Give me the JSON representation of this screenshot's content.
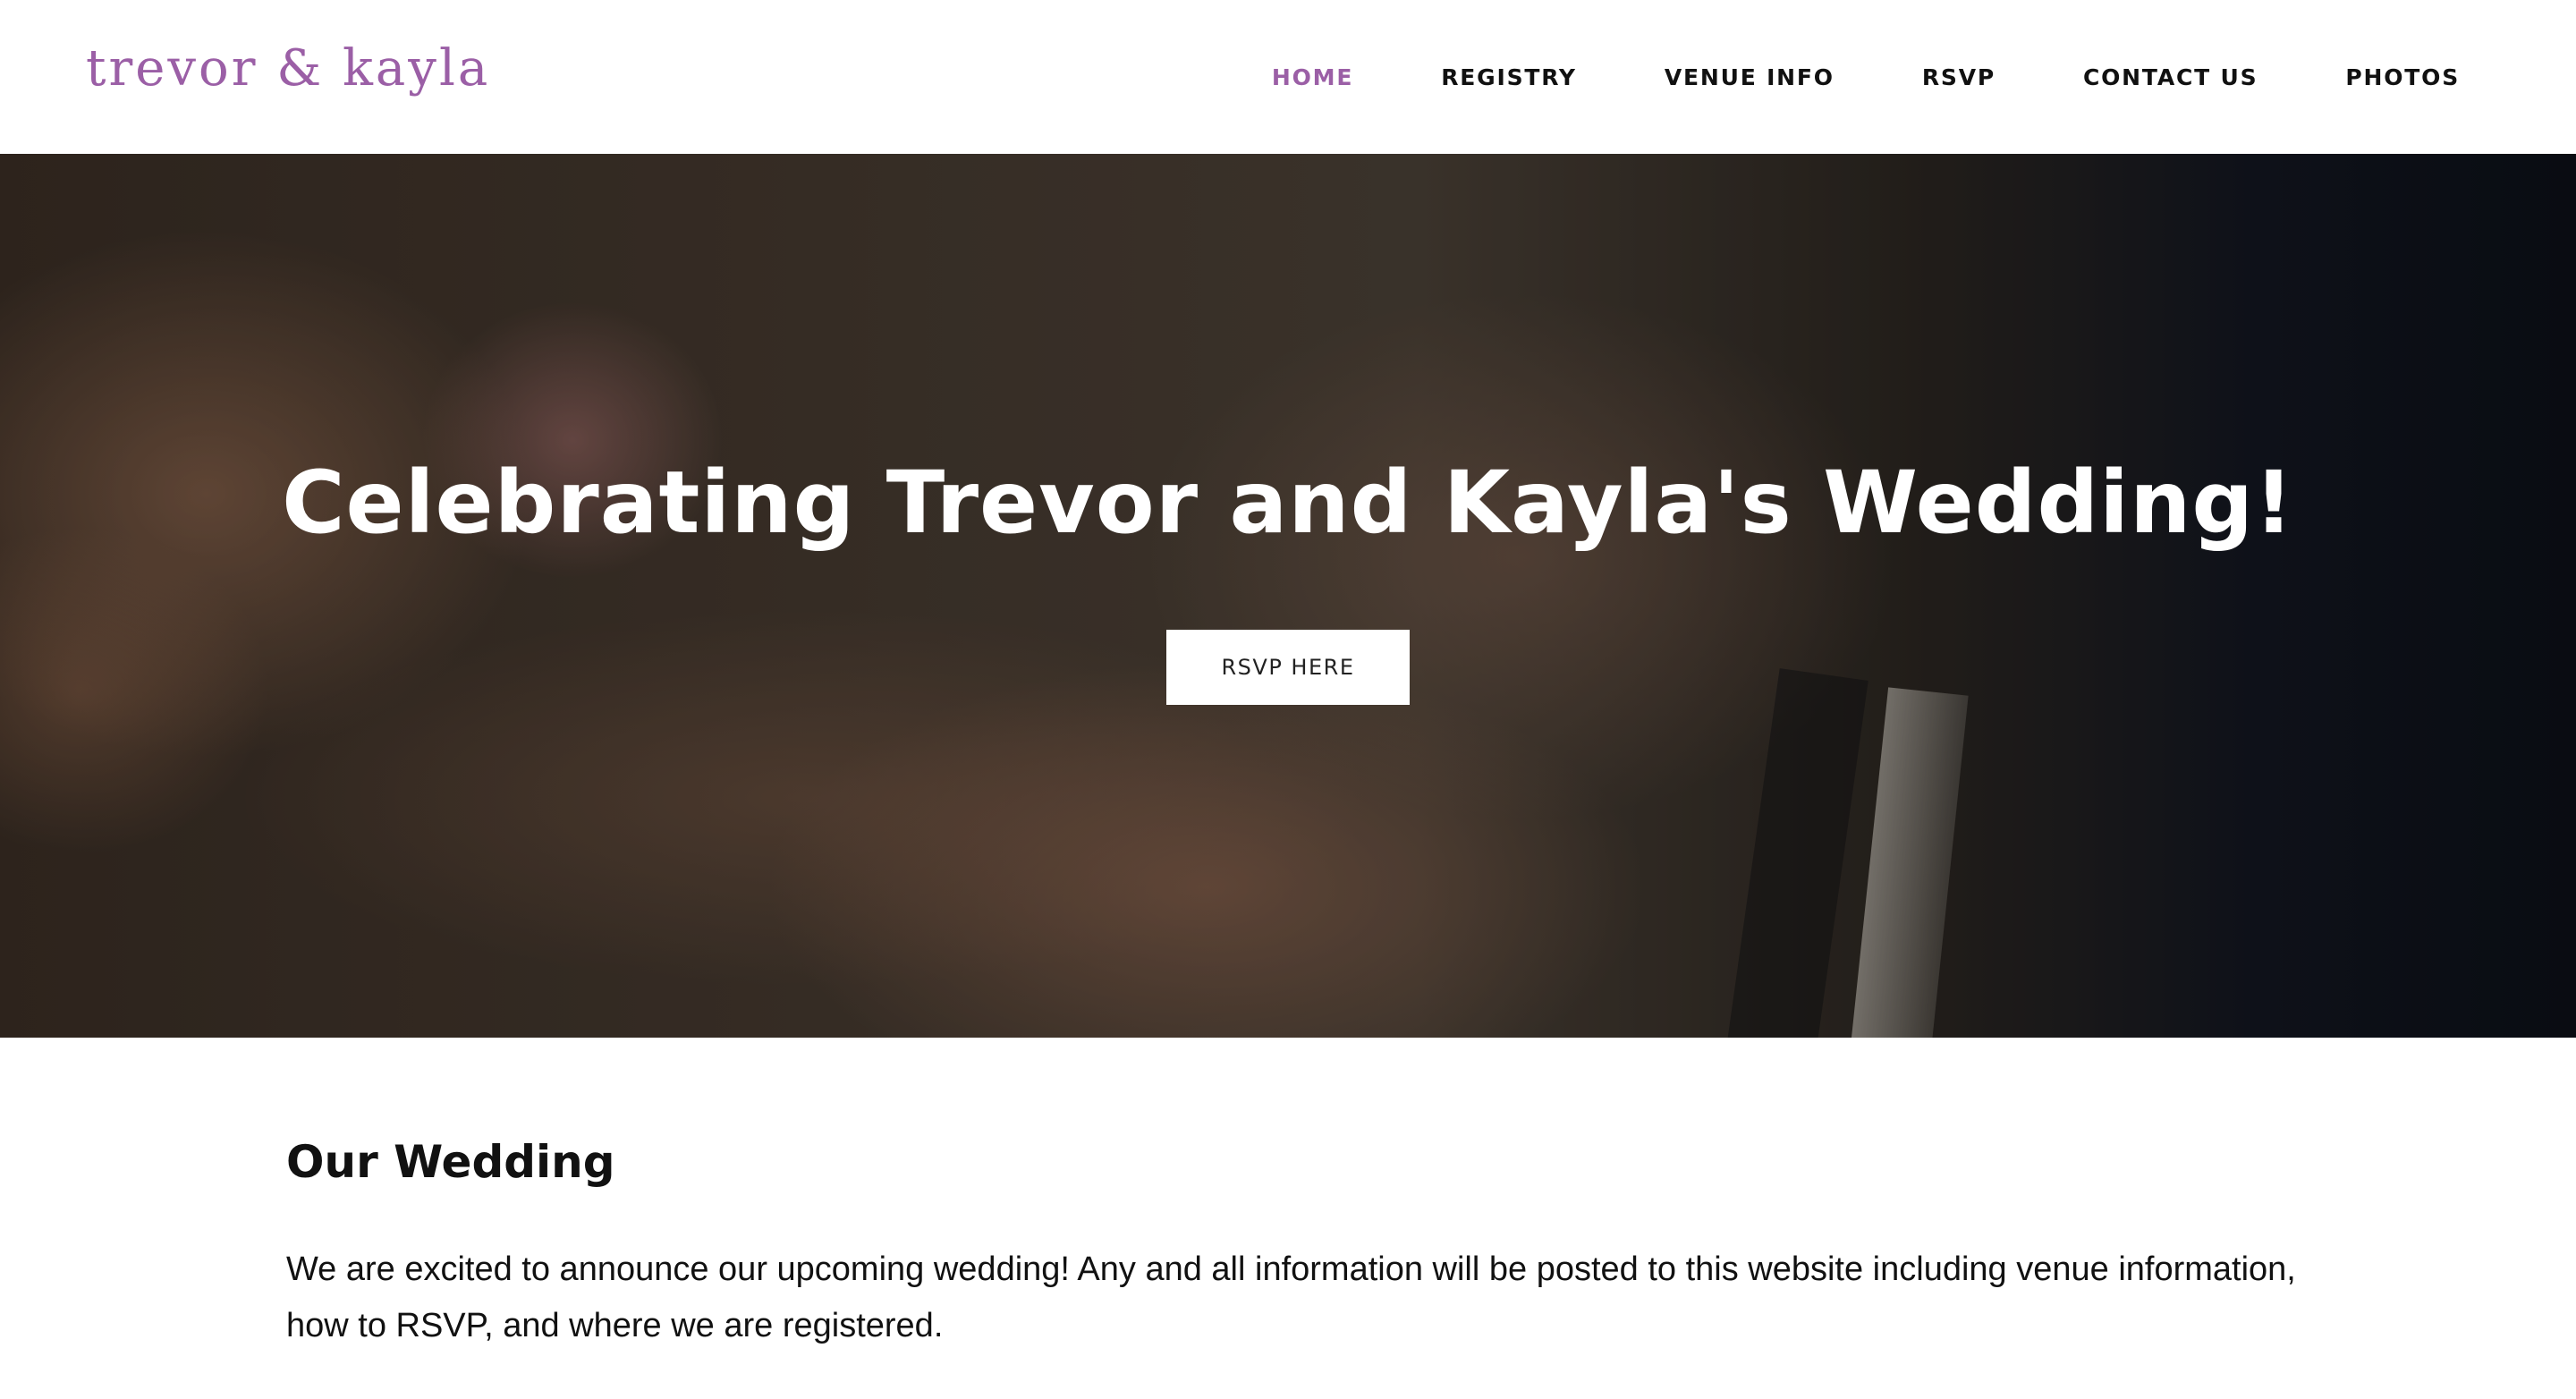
{
  "header": {
    "logo": "trevor & kayla",
    "nav": [
      {
        "label": "HOME",
        "active": true
      },
      {
        "label": "REGISTRY",
        "active": false
      },
      {
        "label": "VENUE INFO",
        "active": false
      },
      {
        "label": "RSVP",
        "active": false
      },
      {
        "label": "CONTACT US",
        "active": false
      },
      {
        "label": "PHOTOS",
        "active": false
      }
    ]
  },
  "hero": {
    "title": "Celebrating Trevor and Kayla's Wedding!",
    "button_label": "RSVP HERE",
    "image_icon": "wedding-hands-ring-photo"
  },
  "main": {
    "section_title": "Our Wedding",
    "section_body": "We are excited to announce our upcoming wedding! Any and all information will be posted to this website including venue information, how to RSVP, and where we are registered."
  },
  "colors": {
    "accent": "#9b5fa6",
    "text": "#111111",
    "background": "#ffffff"
  }
}
